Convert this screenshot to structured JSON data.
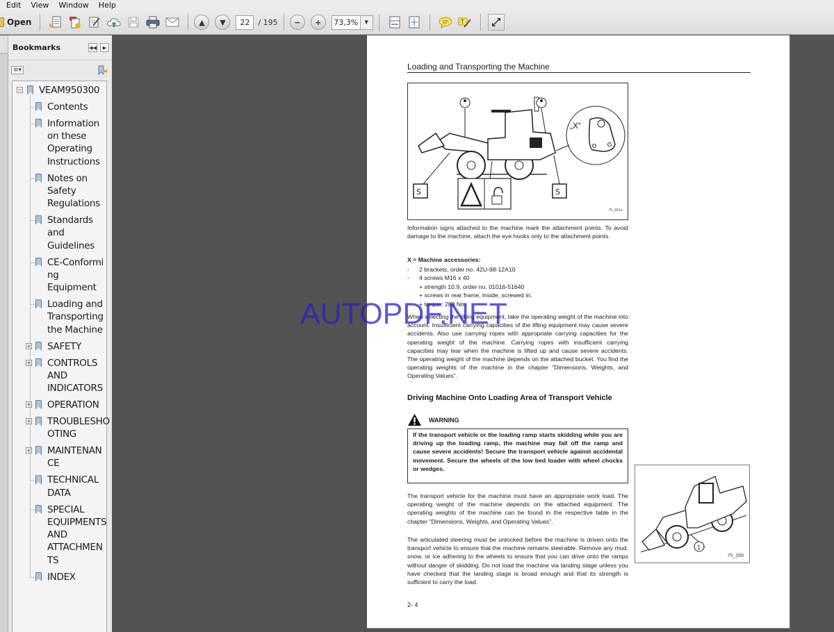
{
  "menu": [
    "Edit",
    "View",
    "Window",
    "Help"
  ],
  "toolbar": {
    "open_label": "Open",
    "icons": [
      "create-pdf-icon",
      "combine-files-icon",
      "edit-icon",
      "upload-cloud-icon",
      "save-icon",
      "print-icon",
      "email-icon"
    ],
    "current_page": "22",
    "total_pages": "/ 195",
    "zoom_level": "73,3%"
  },
  "bookmarks": {
    "title": "Bookmarks",
    "items": [
      {
        "label": "VEAM950300",
        "level": 0,
        "expander": "minus"
      },
      {
        "label": "Contents",
        "level": 1
      },
      {
        "label": "Information\non these\nOperating\nInstructions",
        "level": 1
      },
      {
        "label": "Notes on\nSafety\nRegulations",
        "level": 1
      },
      {
        "label": "Standards\nand\nGuidelines",
        "level": 1
      },
      {
        "label": "CE-Conformi\nng\nEquipment",
        "level": 1
      },
      {
        "label": "Loading and\nTransporting\nthe Machine",
        "level": 1
      },
      {
        "label": "SAFETY",
        "level": 1,
        "expander": "plus"
      },
      {
        "label": "CONTROLS\nAND\nINDICATORS",
        "level": 1,
        "expander": "plus"
      },
      {
        "label": "OPERATION",
        "level": 1,
        "expander": "plus"
      },
      {
        "label": "TROUBLESHO\nOTING",
        "level": 1,
        "expander": "plus"
      },
      {
        "label": "MAINTENAN\nCE",
        "level": 1,
        "expander": "plus"
      },
      {
        "label": "TECHNICAL\nDATA",
        "level": 1
      },
      {
        "label": "SPECIAL\nEQUIPMENTS\nAND\nATTACHMEN\nTS",
        "level": 1
      },
      {
        "label": "INDEX",
        "level": 1
      }
    ]
  },
  "page": {
    "section_title": "Loading and Transporting the Machine",
    "figure1_label": "75_162a",
    "figure1_callout": "„X“",
    "para1": "Information signs attached to the machine mark the attachment points. To avoid damage to the machine, attach the eye hooks only to the attachment points.",
    "accessories_heading": "X = Machine accessories:",
    "accessories": [
      {
        "bullet": "-",
        "text": "2 brackets, order no. 42U-98-12A10"
      },
      {
        "bullet": "-",
        "text": "4 screws M16 x 40"
      },
      {
        "bullet": "",
        "text": "+ strength 10.9, order no. 01016-51640"
      },
      {
        "bullet": "",
        "text": "+ screws in rear frame, inside, screwed in."
      },
      {
        "bullet": "",
        "text": "+ torque: 280 Nm"
      }
    ],
    "para2": "When selecting the lifting equipment, take the operating weight of the machine into account. Insufficient carrying capacities of the lifting equipment may cause severe accidents. Also use carrying ropes with appropriate carrying capacities for the operating weight of the machine. Carrying ropes with insufficient carrying capacities may tear when the machine is lifted up and cause severe accidents. The operating weight of the machine depends on the attached bucket. You find the operating weights of the machine in the chapter \"Dimensions, Weights, and Operating Values\".",
    "subheading": "Driving Machine Onto Loading Area of Transport Vehicle",
    "warning_label": "WARNING",
    "warning_text": "If the transport vehicle or the loading ramp starts skidding while you are driving up the loading ramp, the machine may fall off the ramp and cause severe accidents! Secure the transport vehicle against accidental movement. Secure the wheels of the low bed loader with wheel chocks or wedges.",
    "para3": "The transport vehicle for the machine must have an appropriate work load. The operating weight of the machine depends on the attached equipment. The operating weights of the machine can be found in the respective table in the chapter \"Dimensions, Weights, and Operating Values\".",
    "para4": "The articulated steering must be unlocked before the machine is driven onto the transport vehicle to ensure that the machine remains steerable. Remove any mud, snow, or ice adhering to the wheels to ensure that you can drive onto the ramps without danger of skidding. Do not load the machine via landing stage unless you have checked that the landing stage is broad enough and that its strength is sufficient to carry the load.",
    "figure2_label": "75_269",
    "figure2_callout": "1",
    "page_number": "2- 4"
  },
  "watermark": "AUTOPDF.NET",
  "colors": {
    "canvas_bg": "#535353",
    "panel_bg": "#f4f4f4",
    "bookmark_icon": "#a9c6dc",
    "watermark": "#2b1ec8"
  }
}
